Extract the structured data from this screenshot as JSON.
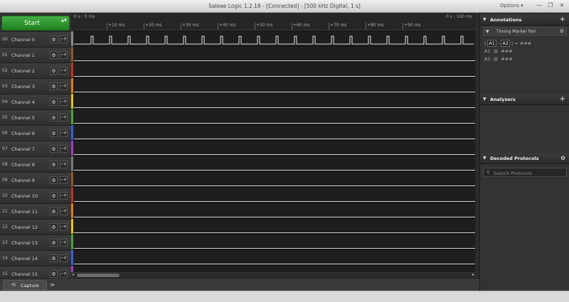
{
  "window": {
    "title": "Saleae Logic 1.2.18 - [Connected] - [500 kHz Digital, 1 s]",
    "options_label": "Options ▾",
    "minimize": "—",
    "restore": "❐",
    "close": "✕"
  },
  "start_button": {
    "label": "Start",
    "spinner": "▲▼"
  },
  "channels": [
    {
      "num": "00",
      "name": "Channel 0",
      "color": "#8a8a8a"
    },
    {
      "num": "01",
      "name": "Channel 1",
      "color": "#8b5a2b"
    },
    {
      "num": "02",
      "name": "Channel 2",
      "color": "#c0302a"
    },
    {
      "num": "03",
      "name": "Channel 3",
      "color": "#e07b22"
    },
    {
      "num": "04",
      "name": "Channel 4",
      "color": "#e0c22a"
    },
    {
      "num": "05",
      "name": "Channel 5",
      "color": "#4da33a"
    },
    {
      "num": "06",
      "name": "Channel 6",
      "color": "#3a5fcf"
    },
    {
      "num": "07",
      "name": "Channel 7",
      "color": "#9b3fc4"
    },
    {
      "num": "08",
      "name": "Channel 8",
      "color": "#7a7a7a"
    },
    {
      "num": "09",
      "name": "Channel 9",
      "color": "#8b5a2b"
    },
    {
      "num": "10",
      "name": "Channel 10",
      "color": "#c0302a"
    },
    {
      "num": "11",
      "name": "Channel 11",
      "color": "#e07b22"
    },
    {
      "num": "12",
      "name": "Channel 12",
      "color": "#e0c22a"
    },
    {
      "num": "13",
      "name": "Channel 13",
      "color": "#4da33a"
    },
    {
      "num": "14",
      "name": "Channel 14",
      "color": "#3a5fcf"
    },
    {
      "num": "15",
      "name": "Channel 15",
      "color": "#9b3fc4"
    }
  ],
  "ruler": {
    "left_label": "0 s : 0 ms",
    "right_label": "0 s : 100 ms",
    "ticks": [
      "+10 ms",
      "+20 ms",
      "+30 ms",
      "+40 ms",
      "+50 ms",
      "+60 ms",
      "+70 ms",
      "+80 ms",
      "+90 ms"
    ]
  },
  "bottom_tab": {
    "label": "Capture",
    "arrow": "≫"
  },
  "annotations": {
    "title": "Annotations",
    "add": "+",
    "marker_label": "Timing Marker Pair",
    "formula_prefix": "| ",
    "a1": "A1",
    "minus": " - ",
    "a2": "A2",
    "formula_suffix": " | = ###",
    "a1_line": "A1  @  ###",
    "a2_line": "A2  @  ###"
  },
  "analyzers": {
    "title": "Analyzers",
    "add": "+"
  },
  "decoded": {
    "title": "Decoded Protocols",
    "search_placeholder": "Search Protocols"
  }
}
